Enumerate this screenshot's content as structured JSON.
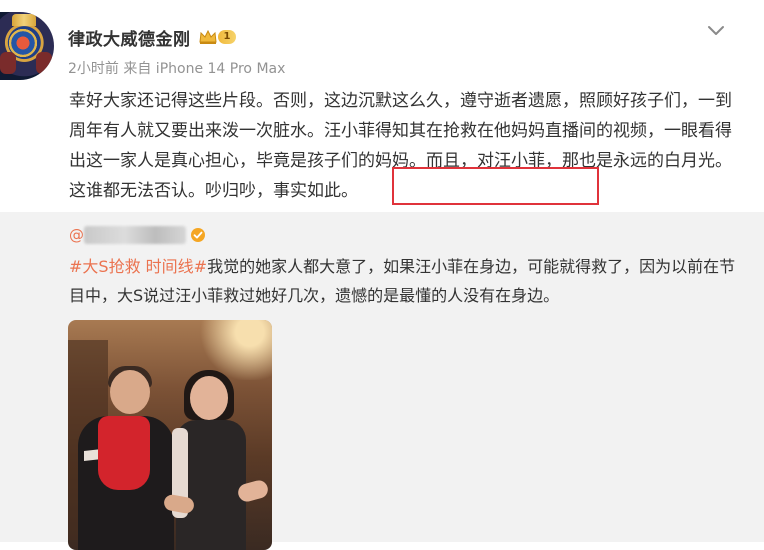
{
  "post": {
    "username": "律政大威德金刚",
    "badge_level": "1",
    "meta": "2小时前  来自 iPhone 14 Pro Max",
    "text": "幸好大家还记得这些片段。否则，这边沉默这么久，遵守逝者遗愿，照顾好孩子们，一到周年有人就又要出来泼一次脏水。汪小菲得知其在抢救在他妈妈直播间的视频，一眼看得出这一家人是真心担心，毕竟是孩子们的妈妈。而且，对汪小菲，那也是永远的白月光。这谁都无法否认。",
    "highlighted_text": "吵归吵，事实如此。"
  },
  "repost": {
    "author_prefix": "@",
    "hashtag1": "#大S抢救",
    "hashtag2": " 时间线#",
    "text": "我觉的她家人都大意了，如果汪小菲在身边，可能就得救了，因为以前在节目中，大S说过汪小菲救过她好几次，遗憾的是最懂的人没有在身边。"
  },
  "colors": {
    "accent_orange": "#eb7350",
    "highlight_red": "#e0333b",
    "badge_gold": "#f0b93c"
  },
  "icons": {
    "more": "chevron-down-icon",
    "vip": "crown-icon",
    "verified": "verified-badge-icon"
  }
}
